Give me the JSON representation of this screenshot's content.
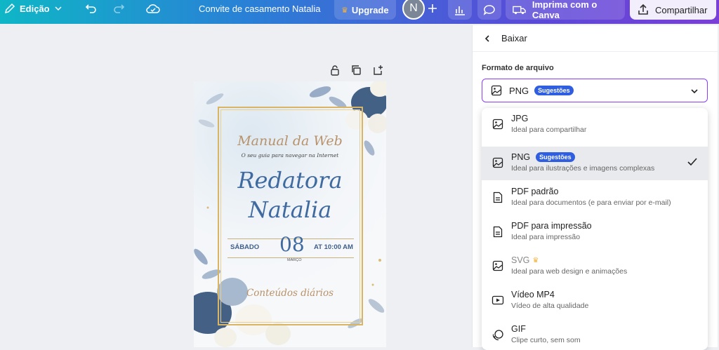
{
  "topbar": {
    "edit_label": "Edição",
    "doc_title": "Convite de casamento Natalia",
    "upgrade_label": "Upgrade",
    "avatar_initial": "N",
    "print_label": "Imprima com o Canva",
    "share_label": "Compartilhar"
  },
  "card": {
    "brand": "Manual da Web",
    "tagline": "O seu guia para navegar na Internet",
    "name_line1": "Redatora",
    "name_line2": "Natalia",
    "day": "SÁBADO",
    "date": "08",
    "month": "MARÇO",
    "time": "AT 10:00 AM",
    "footer": "Conteúdos diários"
  },
  "panel": {
    "back_label": "Baixar",
    "format_label": "Formato de arquivo",
    "selected_value": "PNG",
    "selected_badge": "Sugestões",
    "options": [
      {
        "title": "JPG",
        "desc": "Ideal para compartilhar",
        "icon": "image-icon"
      },
      {
        "title": "PNG",
        "badge": "Sugestões",
        "desc": "Ideal para ilustrações e imagens complexas",
        "icon": "image-icon"
      },
      {
        "title": "PDF padrão",
        "desc": "Ideal para documentos (e para enviar por e-mail)",
        "icon": "document-icon"
      },
      {
        "title": "PDF para impressão",
        "desc": "Ideal para impressão",
        "icon": "document-icon"
      },
      {
        "title": "SVG",
        "desc": "Ideal para web design e animações",
        "icon": "image-icon"
      },
      {
        "title": "Vídeo MP4",
        "desc": "Vídeo de alta qualidade",
        "icon": "video-icon"
      },
      {
        "title": "GIF",
        "desc": "Clipe curto, sem som",
        "icon": "gif-icon"
      }
    ]
  },
  "colors": {
    "accent": "#8b3dff",
    "badge": "#2f5fe0",
    "gold": "#d8b463",
    "script_blue": "#3f6aa0"
  }
}
